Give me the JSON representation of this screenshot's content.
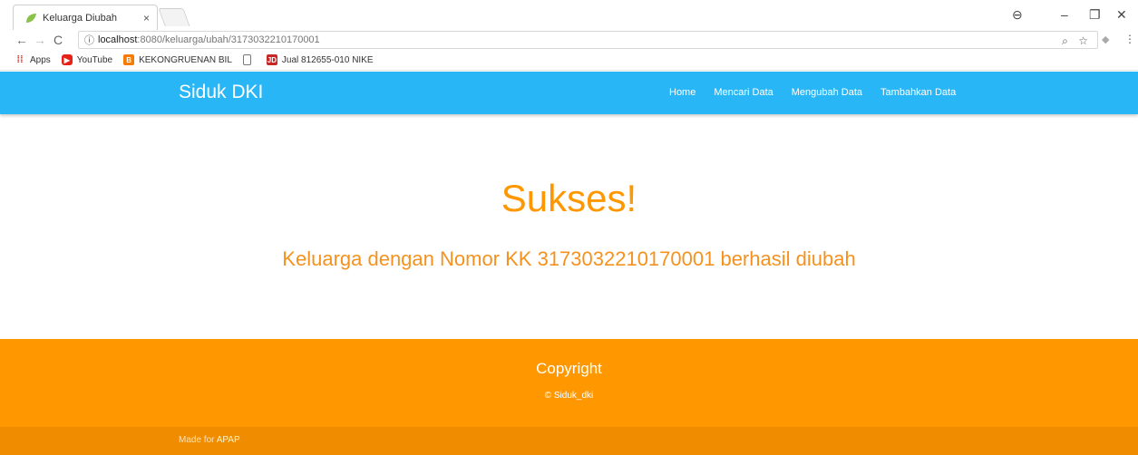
{
  "browser": {
    "tab_title": "Keluarga Diubah",
    "tab_close": "×",
    "url_host": "localhost",
    "url_path": ":8080/keluarga/ubah/3173032210170001",
    "bookmarks": [
      {
        "label": "Apps",
        "icon": "apps-grid-icon"
      },
      {
        "label": "YouTube",
        "icon": "youtube-icon"
      },
      {
        "label": "KEKONGRUENAN BIL",
        "icon": "blogger-icon"
      },
      {
        "label": "",
        "icon": "document-icon"
      },
      {
        "label": "Jual 812655-010 NIKE",
        "icon": "jd-icon"
      }
    ]
  },
  "navbar": {
    "brand": "Siduk DKI",
    "links": [
      "Home",
      "Mencari Data",
      "Mengubah Data",
      "Tambahkan Data"
    ]
  },
  "main": {
    "headline": "Sukses!",
    "message": "Keluarga dengan Nomor KK 3173032210170001 berhasil diubah"
  },
  "footer": {
    "title": "Copyright",
    "subtitle": "© Siduk_dki",
    "made_for_prefix": "Made for ",
    "made_for_link": "APAP"
  },
  "colors": {
    "navbar": "#29b6f6",
    "accent": "#ff9800",
    "footer_bottom": "#ef8c00"
  }
}
